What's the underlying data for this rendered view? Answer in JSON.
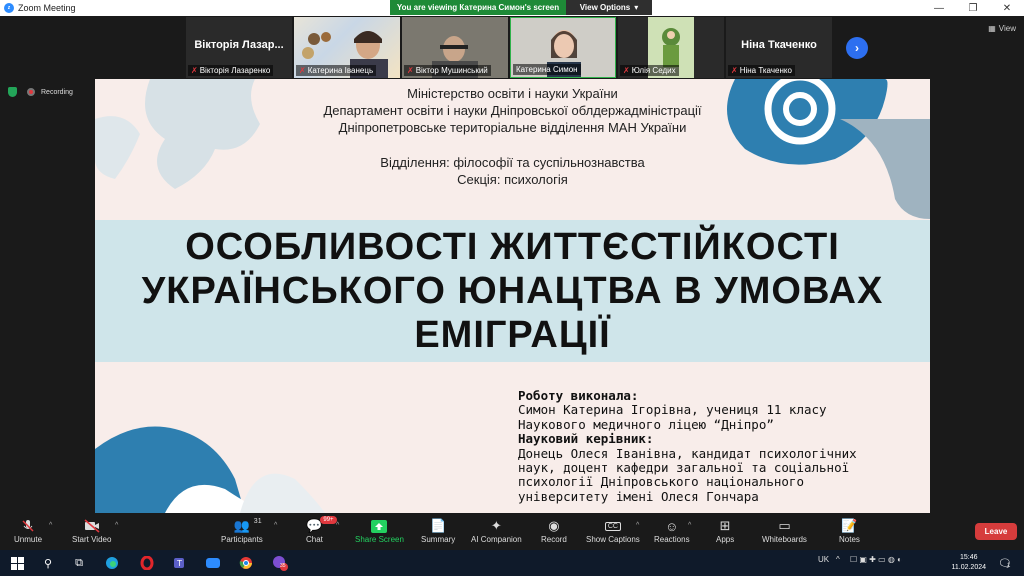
{
  "window": {
    "title": "Zoom Meeting"
  },
  "banner": {
    "viewing": "You are viewing Катерина Симон's screen",
    "view_options": "View Options"
  },
  "view_label": "View",
  "participants_strip": [
    {
      "big_name": "Вікторія  Лазар...",
      "label": "Вікторія Лазаренко",
      "muted": true
    },
    {
      "big_name": "",
      "label": "Катерина Іванець",
      "muted": true
    },
    {
      "big_name": "",
      "label": "Віктор Мушинський",
      "muted": true
    },
    {
      "big_name": "",
      "label": "Катерина Симон",
      "muted": false
    },
    {
      "big_name": "",
      "label": "Юлія Седих",
      "muted": true
    },
    {
      "big_name": "Ніна Ткаченко",
      "label": "Ніна Ткаченко",
      "muted": true
    }
  ],
  "recording": {
    "label": "Recording"
  },
  "slide": {
    "header": [
      "Міністерство освіти і науки України",
      "Департамент освіти і науки Дніпровської облдержадміністрації",
      "Дніпропетровське територіальне відділення МАН України"
    ],
    "department": "Відділення: філософії та суспільнознавства",
    "section": "Секція: психологія",
    "title_lines": [
      "ОСОБЛИВОСТІ ЖИТТЄСТІЙКОСТІ",
      "УКРАЇНСЬКОГО ЮНАЦТВА В УМОВАХ",
      "ЕМІГРАЦІЇ"
    ],
    "author_heading": "Роботу виконала:",
    "author_lines": [
      "Симон Катерина Ігорівна, учениця 11 класу",
      "Наукового медичного ліцею “Дніпро”"
    ],
    "supervisor_heading": "Науковий керівник:",
    "supervisor_lines": [
      "Донець Олеся Іванівна, кандидат психологічних",
      "наук, доцент кафедри загальної та соціальної",
      "психології Дніпровського національного",
      "університету імені Олеся Гончара"
    ]
  },
  "toolbar": {
    "unmute": "Unmute",
    "start_video": "Start Video",
    "participants": "Participants",
    "participants_count": "31",
    "chat": "Chat",
    "chat_badge": "99+",
    "share_screen": "Share Screen",
    "summary": "Summary",
    "ai_companion": "AI Companion",
    "record": "Record",
    "show_captions": "Show Captions",
    "reactions": "Reactions",
    "apps": "Apps",
    "whiteboards": "Whiteboards",
    "notes": "Notes",
    "leave": "Leave"
  },
  "taskbar": {
    "lang": "UK",
    "time": "15:46",
    "date": "11.02.2024",
    "viber_badge": "35",
    "notif_count": "1"
  },
  "colors": {
    "slide_bg": "#f8edea",
    "title_band": "#cfe5ea",
    "accent_blue": "#2e7fb0",
    "share_green": "#23d160",
    "leave_red": "#d63c3c"
  }
}
